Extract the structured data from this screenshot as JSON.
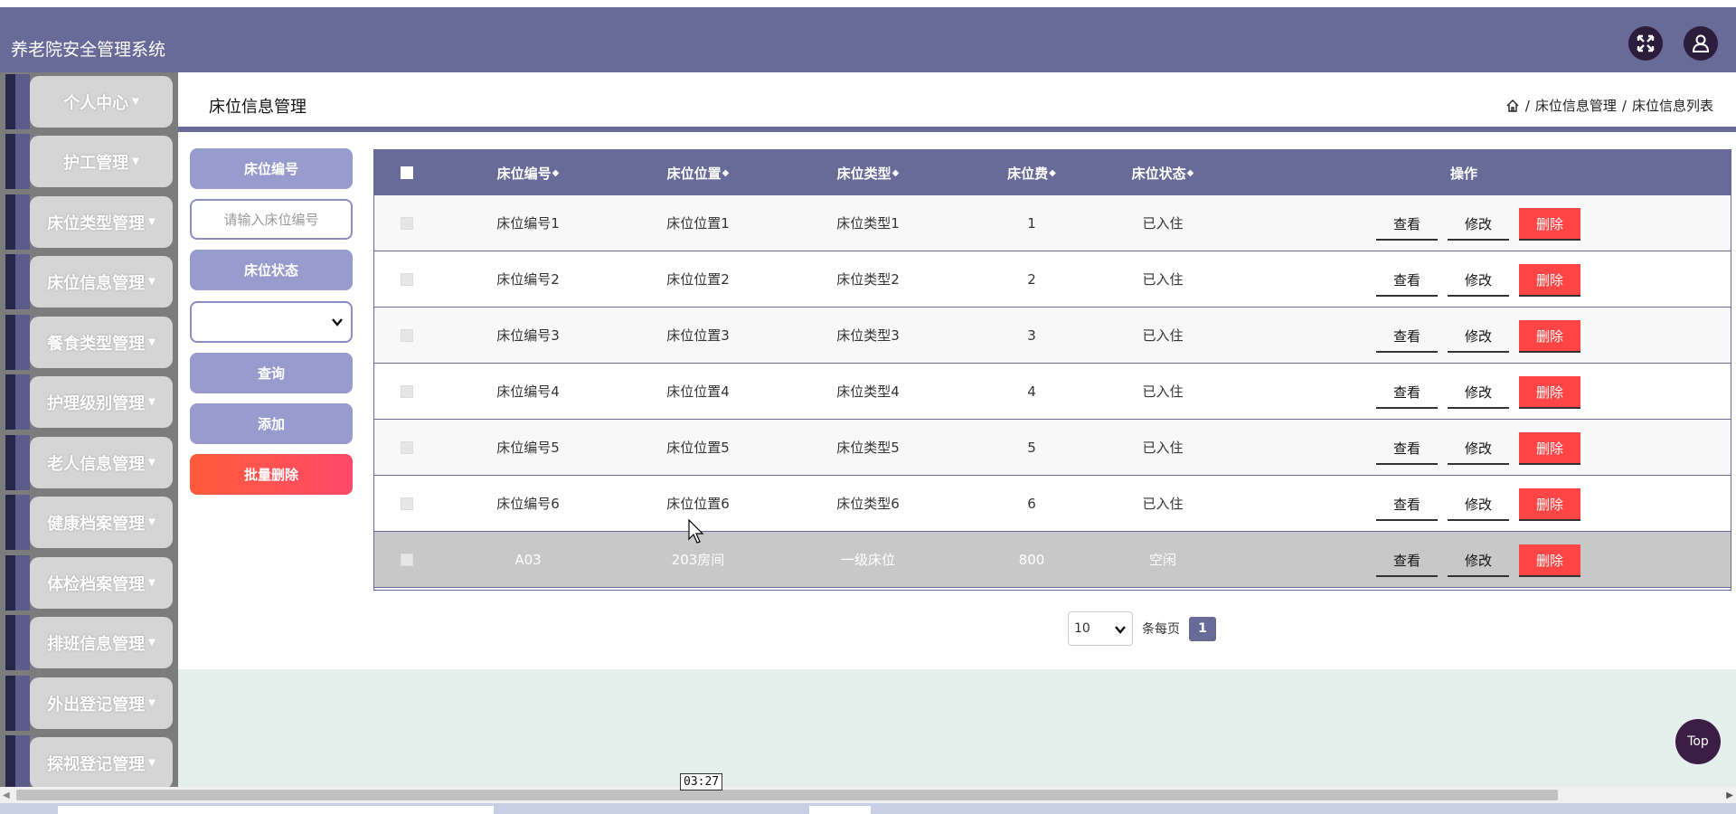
{
  "app": {
    "title": "养老院安全管理系统"
  },
  "header": {
    "fullscreen_icon": "expand-icon",
    "user_icon": "user-icon"
  },
  "sidebar": {
    "items": [
      {
        "label": "个人中心"
      },
      {
        "label": "护工管理"
      },
      {
        "label": "床位类型管理"
      },
      {
        "label": "床位信息管理"
      },
      {
        "label": "餐食类型管理"
      },
      {
        "label": "护理级别管理"
      },
      {
        "label": "老人信息管理"
      },
      {
        "label": "健康档案管理"
      },
      {
        "label": "体检档案管理"
      },
      {
        "label": "排班信息管理"
      },
      {
        "label": "外出登记管理"
      },
      {
        "label": "探视登记管理"
      }
    ]
  },
  "page": {
    "title": "床位信息管理",
    "breadcrumb": [
      "床位信息管理",
      "床位信息列表"
    ]
  },
  "search": {
    "bed_no_label": "床位编号",
    "bed_no_placeholder": "请输入床位编号",
    "status_label": "床位状态",
    "status_value": "",
    "query": "查询",
    "add": "添加",
    "batch_delete": "批量删除"
  },
  "table": {
    "headers": [
      "床位编号",
      "床位位置",
      "床位类型",
      "床位费",
      "床位状态",
      "操作"
    ],
    "rows": [
      {
        "no": "床位编号1",
        "pos": "床位位置1",
        "type": "床位类型1",
        "fee": "1",
        "status": "已入住"
      },
      {
        "no": "床位编号2",
        "pos": "床位位置2",
        "type": "床位类型2",
        "fee": "2",
        "status": "已入住"
      },
      {
        "no": "床位编号3",
        "pos": "床位位置3",
        "type": "床位类型3",
        "fee": "3",
        "status": "已入住"
      },
      {
        "no": "床位编号4",
        "pos": "床位位置4",
        "type": "床位类型4",
        "fee": "4",
        "status": "已入住"
      },
      {
        "no": "床位编号5",
        "pos": "床位位置5",
        "type": "床位类型5",
        "fee": "5",
        "status": "已入住"
      },
      {
        "no": "床位编号6",
        "pos": "床位位置6",
        "type": "床位类型6",
        "fee": "6",
        "status": "已入住"
      },
      {
        "no": "A03",
        "pos": "203房间",
        "type": "一级床位",
        "fee": "800",
        "status": "空闲"
      }
    ],
    "actions": {
      "view": "查看",
      "edit": "修改",
      "delete": "删除"
    }
  },
  "pager": {
    "page_size": "10",
    "per_page_label": "条每页",
    "current_page": "1"
  },
  "top_button": "Top",
  "tooltip": "03:27",
  "colors": {
    "primary": "#686a98",
    "danger": "#ff4545",
    "sidebar_bg": "#7c7c7c",
    "light_button": "#979bcd"
  }
}
